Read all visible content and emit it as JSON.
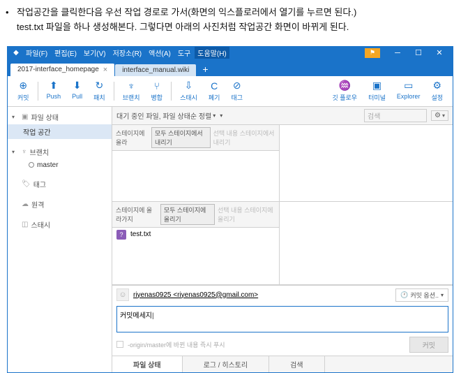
{
  "intro": {
    "line1": "작업공간을 클릭한다음 우선 작업 경로로 가서(화면의 익스플로러에서 열기를 누르면 된다.)",
    "line2": "test.txt 파일을 하나 생성해본다. 그렇다면 아래의 사진처럼 작업공간 화면이 바뀌게 된다."
  },
  "menu": {
    "file": "파일(F)",
    "edit": "편집(E)",
    "view": "보기(V)",
    "repo": "저장소(R)",
    "action": "액션(A)",
    "tool": "도구",
    "help": "도움말(H)"
  },
  "tabs": {
    "t1": "2017-interface_homepage",
    "t2": "interface_manual.wiki"
  },
  "toolbar": {
    "commit": "커밋",
    "push": "Push",
    "pull": "Pull",
    "fetch": "패치",
    "branch": "브랜치",
    "merge": "병합",
    "stash": "스태시",
    "discard": "폐기",
    "tag": "태그",
    "gitflow": "깃 플로우",
    "terminal": "터미널",
    "explorer": "Explorer",
    "settings": "설정"
  },
  "sidebar": {
    "filestatus_header": "파일 상태",
    "workspace": "작업 공간",
    "branch_header": "브랜치",
    "master": "master",
    "tag_header": "태그",
    "remote_header": "원격",
    "stash_header": "스태시"
  },
  "content_bar": {
    "sort": "대기 중인 파일, 파일 상태순 정렬",
    "search_placeholder": "검색"
  },
  "panes": {
    "staged_label": "스테이지에 올라",
    "unstage_all": "모두 스테이지에서 내리기",
    "unstage_sel": "선택 내용 스테이지에서 내리기",
    "unstaged_label": "스테이지에 올라가지",
    "stage_all": "모두 스테이지에 올리기",
    "stage_sel": "선택 내용 스테이지에 올리기",
    "file": "test.txt"
  },
  "commit": {
    "user": "riyenas0925 <riyenas0925@gmail.com>",
    "options": "커밋 옵션..",
    "message": "커밋메세지",
    "push_check": "-origin/master에 바뀐 내용 즉시 푸시",
    "button": "커밋"
  },
  "bottom": {
    "tab1": "파일 상태",
    "tab2": "로그 / 히스토리",
    "tab3": "검색"
  }
}
